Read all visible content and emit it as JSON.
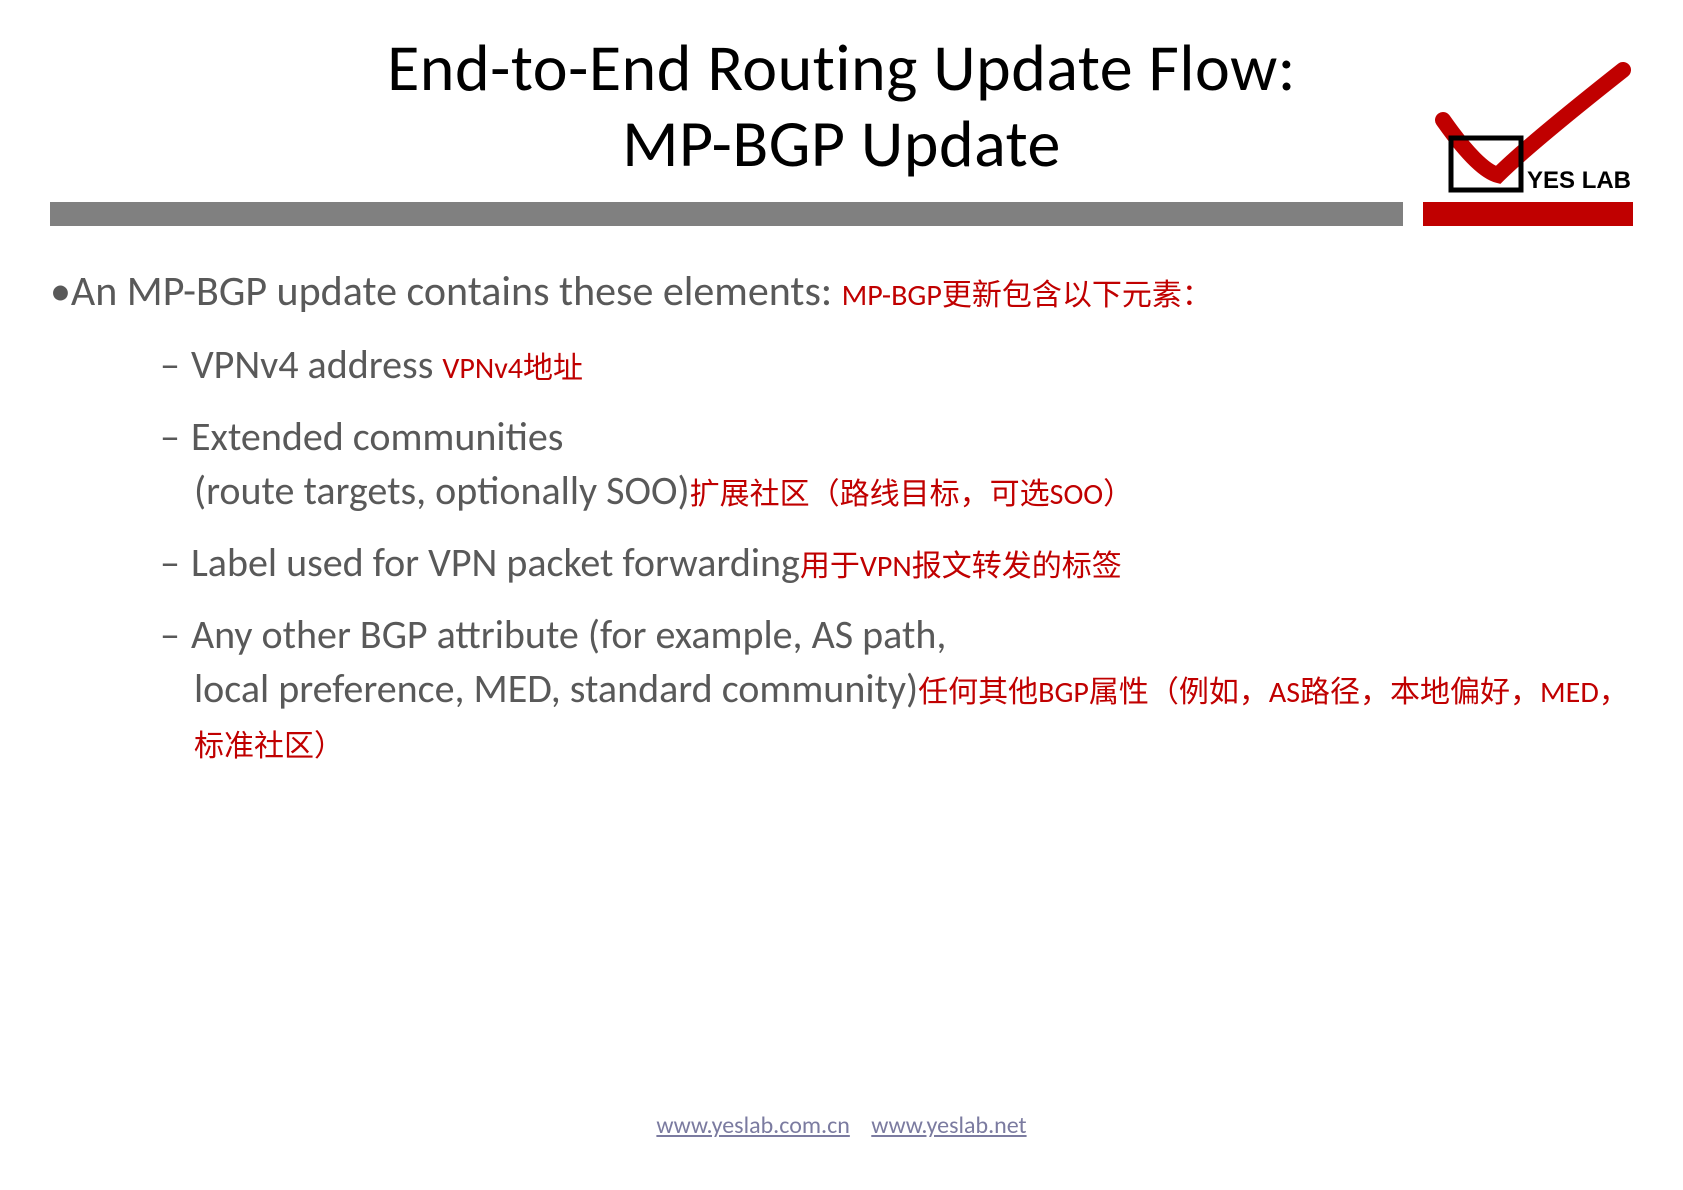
{
  "title": {
    "line1": "End-to-End Routing Update Flow:",
    "line2": "MP-BGP Update"
  },
  "logo": {
    "text": "YES LAB"
  },
  "bullet1": {
    "text": "An MP-BGP update contains these elements:",
    "annot": "MP-BGP更新包含以下元素："
  },
  "items": [
    {
      "text": "VPNv4 address ",
      "annot": "VPNv4地址"
    },
    {
      "text_a": "Extended communities",
      "text_b": "(route targets, optionally SOO)",
      "annot": "扩展社区（路线目标，可选SOO）"
    },
    {
      "text": "Label used for VPN packet forwarding",
      "annot": "用于VPN报文转发的标签"
    },
    {
      "text_a": "Any other BGP attribute (for example, AS path,",
      "text_b": "local preference, MED, standard community)",
      "annot": "任何其他BGP属性（例如，AS路径，本地偏好，MED，标准社区）"
    }
  ],
  "footer": {
    "link1": "www.yeslab.com.cn",
    "link2": "www.yeslab.net"
  }
}
